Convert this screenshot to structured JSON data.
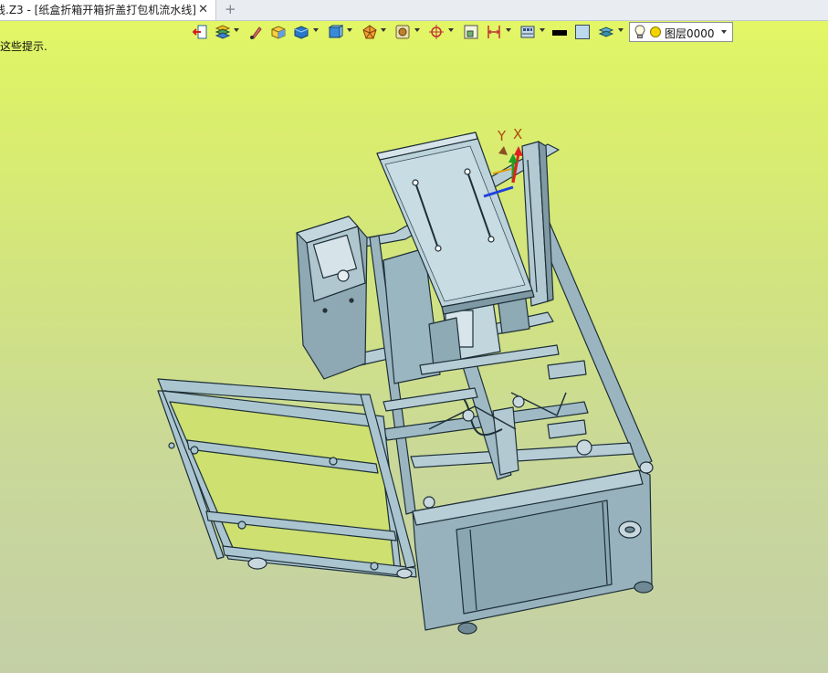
{
  "tab": {
    "title": "线.Z3 - [纸盒折箱开箱折盖打包机流水线]",
    "close_glyph": "✕",
    "add_glyph": "+"
  },
  "toolbar": {
    "icons": [
      "exit-icon",
      "layers-icon",
      "brush-icon",
      "box-icon",
      "solid-cube-icon",
      "view-cube-icon",
      "orient-icon",
      "render-icon",
      "origin-icon",
      "frame-icon",
      "dimension-icon",
      "toolbar-icon",
      "line-color-icon",
      "fill-color-icon",
      "stack-icon"
    ],
    "line_color": "#000000",
    "fill_color": "#bcd9ee"
  },
  "layer": {
    "name": "图层0000"
  },
  "hint": "这些提示.",
  "triad": {
    "x_label": "X",
    "y_label": "Y"
  },
  "colors": {
    "model_fill": "#a9c4ce",
    "model_edge": "#1e2f38",
    "bg_top": "#e4f864",
    "bg_bottom": "#c4cfa6"
  }
}
